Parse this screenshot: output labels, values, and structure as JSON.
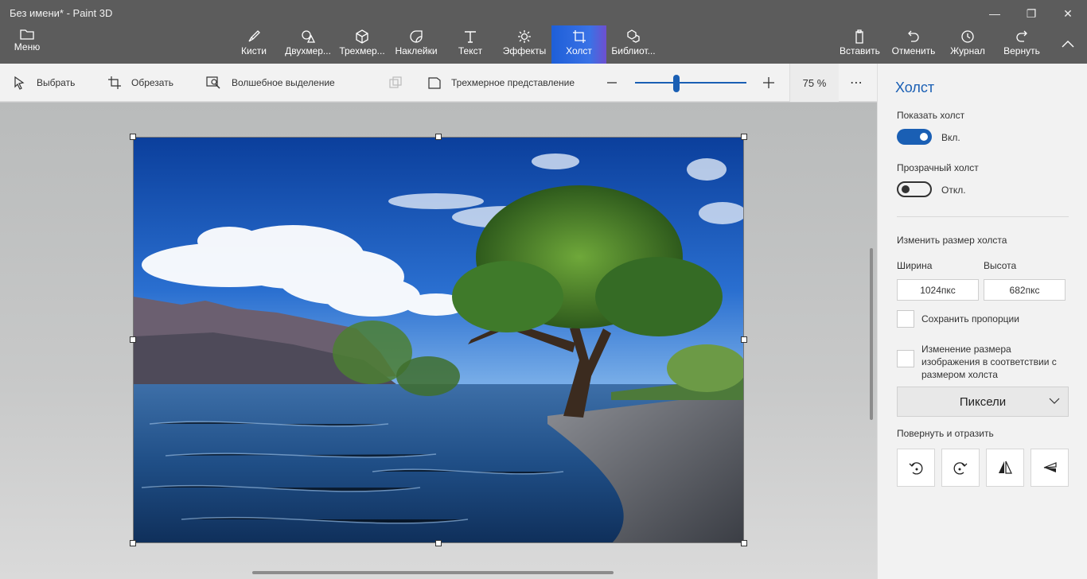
{
  "window": {
    "title": "Без имени* - Paint 3D"
  },
  "menu": {
    "label": "Меню"
  },
  "tools": [
    {
      "label": "Кисти"
    },
    {
      "label": "Двухмер..."
    },
    {
      "label": "Трехмер..."
    },
    {
      "label": "Наклейки"
    },
    {
      "label": "Текст"
    },
    {
      "label": "Эффекты"
    },
    {
      "label": "Холст",
      "active": true
    },
    {
      "label": "Библиот..."
    }
  ],
  "actions": [
    {
      "label": "Вставить"
    },
    {
      "label": "Отменить"
    },
    {
      "label": "Журнал"
    },
    {
      "label": "Вернуть"
    }
  ],
  "subtoolbar": {
    "select": "Выбрать",
    "crop": "Обрезать",
    "magic_select": "Волшебное выделение",
    "view_3d": "Трехмерное представление",
    "zoom_percent": "75 %",
    "zoom_level": 0.37
  },
  "panel": {
    "title": "Холст",
    "show_canvas": {
      "label": "Показать холст",
      "state": "Вкл."
    },
    "transparent_canvas": {
      "label": "Прозрачный холст",
      "state": "Откл."
    },
    "resize_label": "Изменить размер холста",
    "width_label": "Ширина",
    "height_label": "Высота",
    "width_value": "1024пкс",
    "height_value": "682пкс",
    "keep_ratio": "Сохранить пропорции",
    "resize_image_line1": "Изменение размера",
    "resize_image_line2": "изображения в соответствии с",
    "resize_image_line3": "размером холста",
    "units": "Пиксели",
    "rotate_flip": "Повернуть и отразить"
  },
  "colors": {
    "accent": "#1a5fb4",
    "titlebar": "#5c5c5c",
    "underline": "#e81123"
  }
}
